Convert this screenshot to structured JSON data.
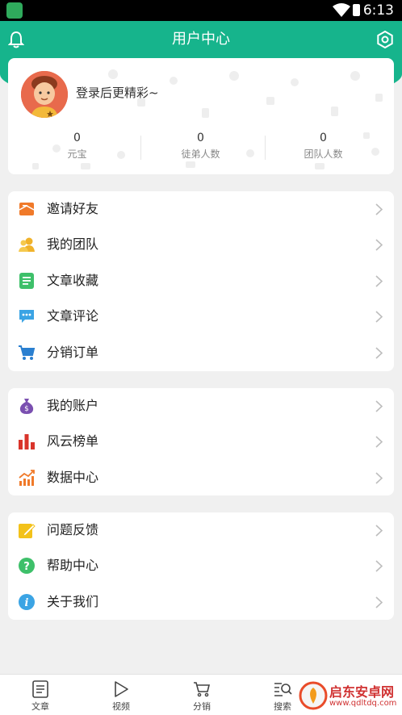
{
  "status_bar": {
    "time": "6:13"
  },
  "header": {
    "title": "用户中心"
  },
  "profile": {
    "login_prompt": "登录后更精彩~",
    "stats": [
      {
        "value": "0",
        "label": "元宝"
      },
      {
        "value": "0",
        "label": "徒弟人数"
      },
      {
        "value": "0",
        "label": "团队人数"
      }
    ]
  },
  "menu": {
    "group1": [
      {
        "label": "邀请好友",
        "icon": "envelope-icon"
      },
      {
        "label": "我的团队",
        "icon": "team-icon"
      },
      {
        "label": "文章收藏",
        "icon": "document-icon"
      },
      {
        "label": "文章评论",
        "icon": "comment-icon"
      },
      {
        "label": "分销订单",
        "icon": "cart-icon"
      }
    ],
    "group2": [
      {
        "label": "我的账户",
        "icon": "money-bag-icon"
      },
      {
        "label": "风云榜单",
        "icon": "bar-chart-icon"
      },
      {
        "label": "数据中心",
        "icon": "trend-chart-icon"
      }
    ],
    "group3": [
      {
        "label": "问题反馈",
        "icon": "edit-note-icon"
      },
      {
        "label": "帮助中心",
        "icon": "question-icon"
      },
      {
        "label": "关于我们",
        "icon": "info-icon"
      }
    ]
  },
  "tabbar": [
    {
      "label": "文章",
      "icon": "article-icon"
    },
    {
      "label": "视频",
      "icon": "play-icon"
    },
    {
      "label": "分销",
      "icon": "cart-icon"
    },
    {
      "label": "搜索",
      "icon": "search-list-icon"
    }
  ],
  "watermark": {
    "line1": "启东安卓网",
    "line2": "www.qdltdq.com"
  },
  "colors": {
    "accent": "#16b48c",
    "background": "#f0f0f0"
  }
}
